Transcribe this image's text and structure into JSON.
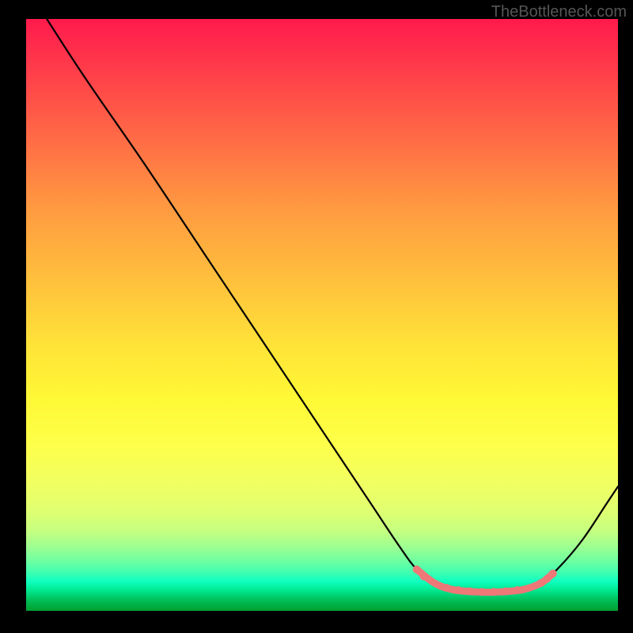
{
  "watermark": "TheBottleneck.com",
  "chart_data": {
    "type": "line",
    "title": "",
    "xlabel": "",
    "ylabel": "",
    "xlim": [
      0,
      100
    ],
    "ylim": [
      0,
      100
    ],
    "series": [
      {
        "name": "curve",
        "color": "#000000",
        "points": [
          {
            "x": 3.5,
            "y": 100
          },
          {
            "x": 10,
            "y": 90
          },
          {
            "x": 20,
            "y": 75.5
          },
          {
            "x": 30,
            "y": 60.5
          },
          {
            "x": 40,
            "y": 45.5
          },
          {
            "x": 50,
            "y": 30.5
          },
          {
            "x": 58,
            "y": 18.5
          },
          {
            "x": 63,
            "y": 11
          },
          {
            "x": 66,
            "y": 7
          },
          {
            "x": 69,
            "y": 4.7
          },
          {
            "x": 72,
            "y": 3.6
          },
          {
            "x": 76,
            "y": 3.2
          },
          {
            "x": 80,
            "y": 3.2
          },
          {
            "x": 84,
            "y": 3.6
          },
          {
            "x": 87,
            "y": 4.7
          },
          {
            "x": 90,
            "y": 7.3
          },
          {
            "x": 94,
            "y": 12
          },
          {
            "x": 98,
            "y": 18
          },
          {
            "x": 100,
            "y": 21
          }
        ]
      },
      {
        "name": "highlight-band",
        "color": "#ee7777",
        "points": [
          {
            "x": 66,
            "y": 7
          },
          {
            "x": 69,
            "y": 4.7
          },
          {
            "x": 72,
            "y": 3.6
          },
          {
            "x": 76,
            "y": 3.2
          },
          {
            "x": 80,
            "y": 3.2
          },
          {
            "x": 84,
            "y": 3.6
          },
          {
            "x": 87,
            "y": 4.7
          },
          {
            "x": 89,
            "y": 6.3
          }
        ]
      }
    ],
    "markers": [
      {
        "x": 66,
        "y": 7,
        "color": "#ee7777"
      },
      {
        "x": 67.2,
        "y": 5.8,
        "color": "#ee7777"
      },
      {
        "x": 71,
        "y": 3.9,
        "color": "#ee7777"
      },
      {
        "x": 73,
        "y": 3.5,
        "color": "#ee7777"
      },
      {
        "x": 75,
        "y": 3.3,
        "color": "#ee7777"
      },
      {
        "x": 77,
        "y": 3.2,
        "color": "#ee7777"
      },
      {
        "x": 79,
        "y": 3.2,
        "color": "#ee7777"
      },
      {
        "x": 81,
        "y": 3.3,
        "color": "#ee7777"
      },
      {
        "x": 83,
        "y": 3.5,
        "color": "#ee7777"
      },
      {
        "x": 87,
        "y": 4.7,
        "color": "#ee7777"
      },
      {
        "x": 88,
        "y": 5.4,
        "color": "#ee7777"
      },
      {
        "x": 89,
        "y": 6.3,
        "color": "#ee7777"
      }
    ]
  }
}
